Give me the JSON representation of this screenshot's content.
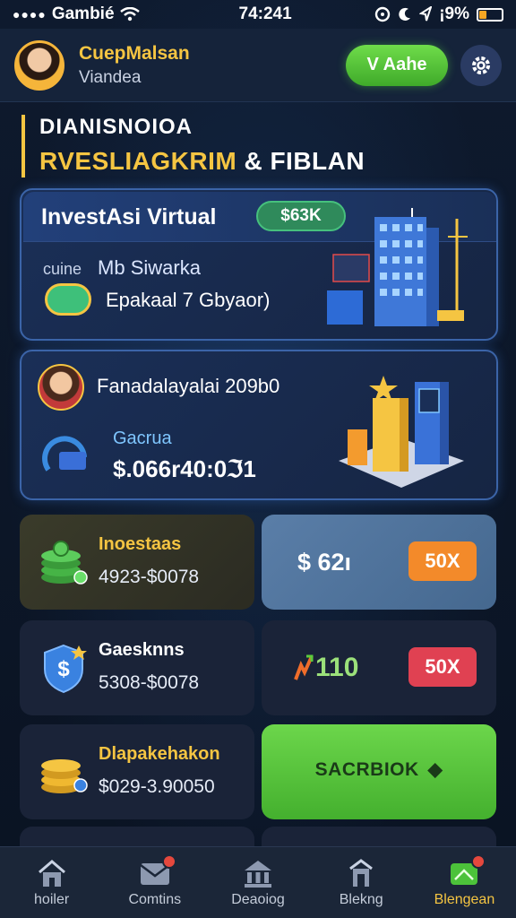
{
  "status_bar": {
    "carrier": "Gambié",
    "time": "74:241",
    "battery_text": "¡9%"
  },
  "header": {
    "user_name": "CuepMalsan",
    "user_sub": "Viandea",
    "action_label": "V Aahe",
    "avatar_icon": "user-avatar",
    "settings_icon": "gear-icon"
  },
  "title": {
    "line1": "DIANISNOIOA",
    "line2_yellow": "RVESLIAGKRIM",
    "line2_white": "& FIBLAN"
  },
  "card_investasi": {
    "title": "InvestAsi Virtual",
    "badge": "$63K",
    "small_label": "cuine",
    "name": "Mb Siwarka",
    "description": "Epakaal 7 Gbyaor)"
  },
  "card_performance": {
    "title": "Fanadalayalai 209b0",
    "label": "Gacrua",
    "value": "$.066r40:0ℑ1"
  },
  "tiles": [
    {
      "title": "Inoestaas",
      "value": "4923-$0078",
      "icon": "money-stack-icon"
    },
    {
      "title": "Gaesknns",
      "value": "5308-$0078",
      "icon": "shield-dollar-icon"
    },
    {
      "title": "Dlapakehakon",
      "value": "$029-3.90050",
      "icon": "coin-stack-icon"
    }
  ],
  "right_tiles": [
    {
      "amount": "$ 62ı",
      "badge": "50X",
      "badge_color": "#f38a2a"
    },
    {
      "amount": "110",
      "badge": "50X",
      "badge_color": "#e04152"
    },
    {
      "cta": "SACRBIOK",
      "chevron": "◆"
    }
  ],
  "bottom_nav": [
    {
      "label": "hoiler",
      "icon": "home-icon"
    },
    {
      "label": "Comtins",
      "icon": "mail-icon"
    },
    {
      "label": "Deaoiog",
      "icon": "bank-icon"
    },
    {
      "label": "Blekng",
      "icon": "building-icon"
    },
    {
      "label": "Blengean",
      "icon": "wallet-icon",
      "active": true
    }
  ],
  "colors": {
    "accent_yellow": "#f5c542",
    "accent_green": "#5ccc3c",
    "background": "#0b1424"
  }
}
